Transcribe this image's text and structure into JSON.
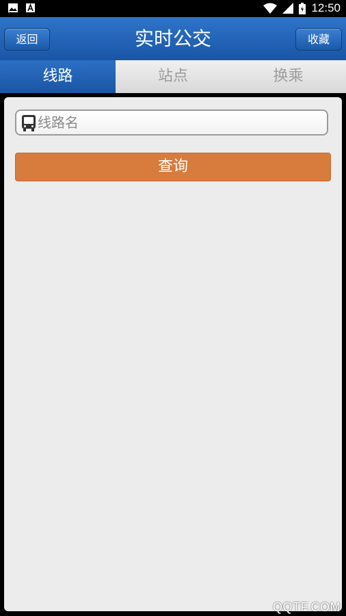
{
  "status_bar": {
    "time": "12:50",
    "icons": [
      "image-icon",
      "a-notification-icon",
      "wifi-icon",
      "signal-icon",
      "battery-icon"
    ]
  },
  "header": {
    "title": "实时公交",
    "back_label": "返回",
    "favorite_label": "收藏"
  },
  "tabs": [
    {
      "label": "线路",
      "active": true
    },
    {
      "label": "站点",
      "active": false
    },
    {
      "label": "换乘",
      "active": false
    }
  ],
  "search": {
    "placeholder": "线路名",
    "value": "",
    "icon": "bus-icon"
  },
  "query_button": {
    "label": "查询"
  },
  "watermark": "QQTF.COM",
  "colors": {
    "header_blue": "#1a55a6",
    "active_tab_blue": "#2b70c4",
    "query_orange": "#d87c3e",
    "panel_bg": "#ececec"
  }
}
